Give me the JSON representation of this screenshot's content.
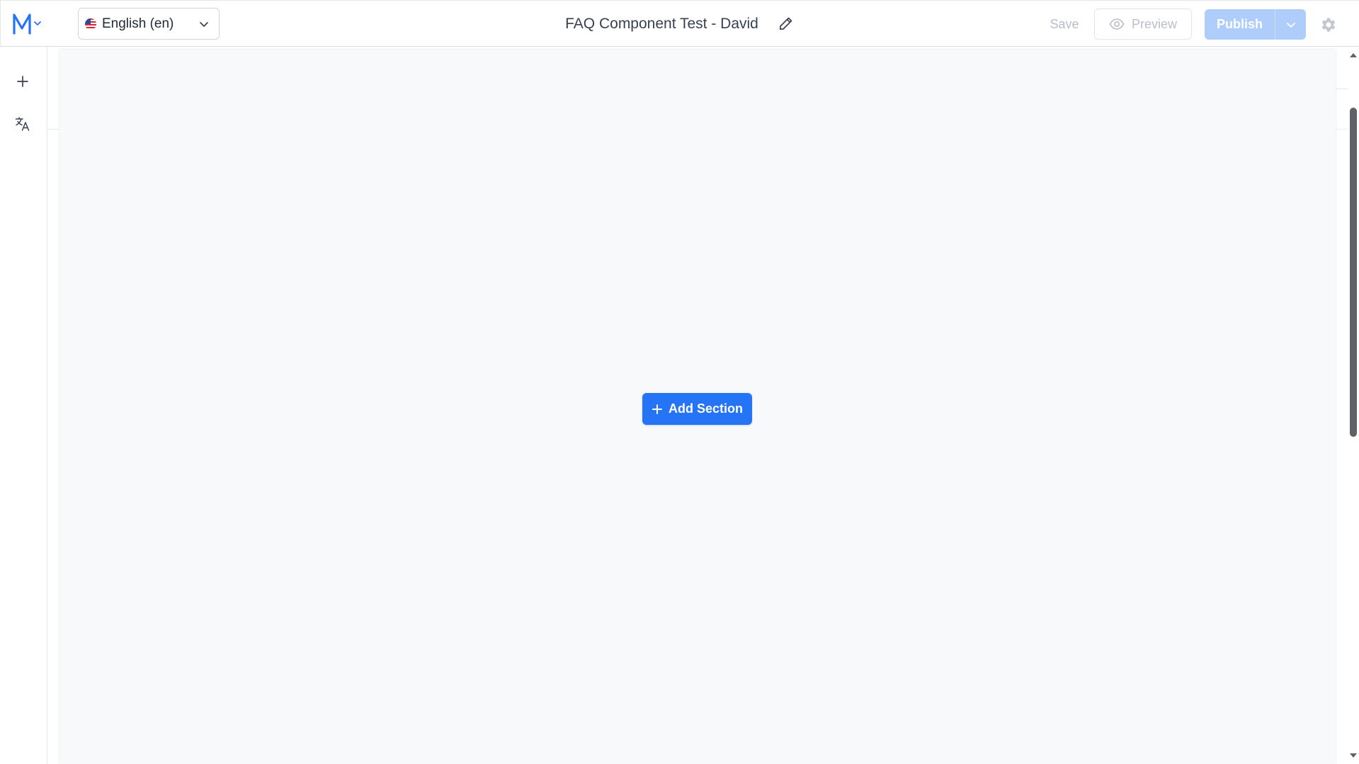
{
  "header": {
    "logo_icon": "m-logo-icon",
    "language": {
      "flag_icon": "us-flag-icon",
      "label": "English (en)"
    },
    "title": "FAQ Component Test - David",
    "edit_icon": "pencil-icon",
    "save_label": "Save",
    "preview_label": "Preview",
    "publish_label": "Publish",
    "settings_icon": "gear-icon"
  },
  "sidebar": {
    "items": [
      {
        "icon": "plus-icon",
        "name": "add"
      },
      {
        "icon": "translate-icon",
        "name": "translate"
      }
    ]
  },
  "canvas": {
    "add_section_label": "Add Section"
  },
  "colors": {
    "accent": "#2574f5",
    "publish_disabled": "#aecdfb",
    "canvas_bg": "#f8f9fb",
    "muted_text": "#b9bec7"
  }
}
